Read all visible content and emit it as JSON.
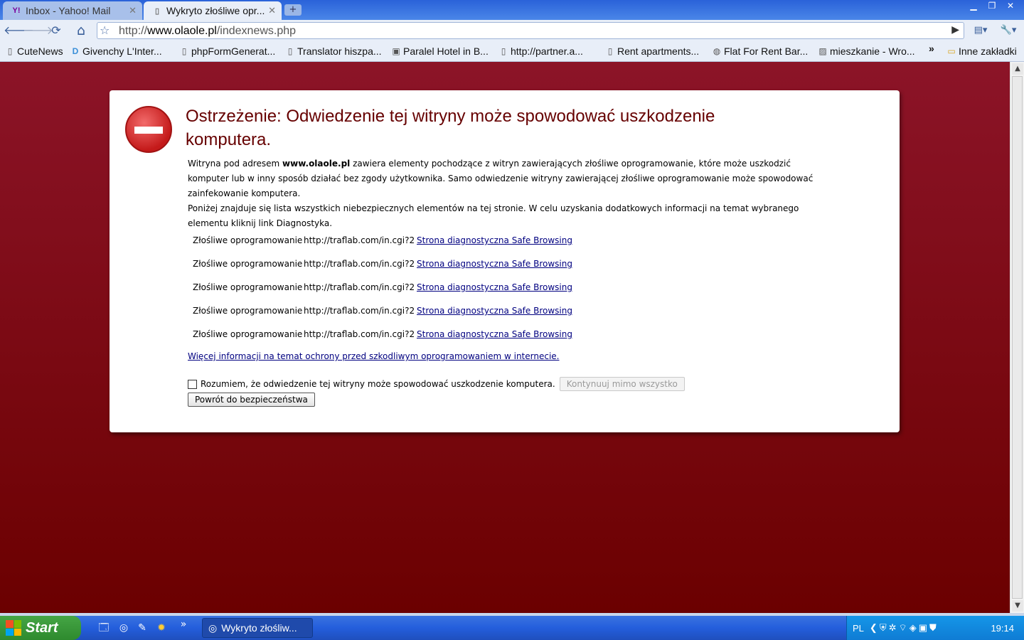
{
  "tabs": [
    {
      "title": "Inbox - Yahoo! Mail",
      "favicon": "Y!",
      "active": false
    },
    {
      "title": "Wykryto złośliwe opr...",
      "favicon": "▯",
      "active": true
    }
  ],
  "window_controls": {
    "minimize": "▁",
    "maximize": "❐",
    "close": "✕"
  },
  "toolbar": {
    "back_icon": "🡐",
    "forward_icon": "🡒",
    "reload_icon": "⟳",
    "home_icon": "⌂",
    "star_icon": "☆",
    "url_prefix": "http://",
    "url_host": "www.olaole.pl",
    "url_path": "/indexnews.php",
    "go_icon": "▶",
    "page_menu_icon": "▤▾",
    "wrench_icon": "🔧▾"
  },
  "bookmarks": [
    {
      "label": "CuteNews",
      "icon": "▯"
    },
    {
      "label": "Givenchy L'Inter...",
      "icon": "D"
    },
    {
      "label": "phpFormGenerat...",
      "icon": "▯"
    },
    {
      "label": "Translator hiszpa...",
      "icon": "▯"
    },
    {
      "label": "Paralel Hotel in B...",
      "icon": "▣"
    },
    {
      "label": "http://partner.a...",
      "icon": "▯"
    },
    {
      "label": "Rent apartments...",
      "icon": "▯"
    },
    {
      "label": "Flat For Rent Bar...",
      "icon": "◍"
    },
    {
      "label": "mieszkanie - Wro...",
      "icon": "▨"
    }
  ],
  "bookmarks_overflow": "»",
  "other_bookmarks": "Inne zakładki",
  "warning": {
    "headline": "Ostrzeżenie: Odwiedzenie tej witryny może spowodować uszkodzenie komputera.",
    "p1_before": "Witryna pod adresem ",
    "p1_site": "www.olaole.pl",
    "p1_after": " zawiera elementy pochodzące z witryn zawierających złośliwe oprogramowanie, które może uszkodzić komputer lub w inny sposób działać bez zgody użytkownika. Samo odwiedzenie witryny zawierającej złośliwe oprogramowanie może spowodować zainfekowanie komputera.",
    "p2": "Poniżej znajduje się lista wszystkich niebezpiecznych elementów na tej stronie. W celu uzyskania dodatkowych informacji na temat wybranego elementu kliknij link Diagnostyka.",
    "threats": [
      {
        "type": "Złośliwe oprogramowanie",
        "url": "http://traflab.com/in.cgi?2",
        "link": "Strona diagnostyczna Safe Browsing"
      },
      {
        "type": "Złośliwe oprogramowanie",
        "url": "http://traflab.com/in.cgi?2",
        "link": "Strona diagnostyczna Safe Browsing"
      },
      {
        "type": "Złośliwe oprogramowanie",
        "url": "http://traflab.com/in.cgi?2",
        "link": "Strona diagnostyczna Safe Browsing"
      },
      {
        "type": "Złośliwe oprogramowanie",
        "url": "http://traflab.com/in.cgi?2",
        "link": "Strona diagnostyczna Safe Browsing"
      },
      {
        "type": "Złośliwe oprogramowanie",
        "url": "http://traflab.com/in.cgi?2",
        "link": "Strona diagnostyczna Safe Browsing"
      }
    ],
    "more_info": "Więcej informacji na temat ochrony przed szkodliwym oprogramowaniem w internecie.",
    "acknowledge": "Rozumiem, że odwiedzenie tej witryny może spowodować uszkodzenie komputera.",
    "continue_button": "Kontynuuj mimo wszystko",
    "back_button": "Powrót do bezpieczeństwa"
  },
  "taskbar": {
    "start": "Start",
    "quicklaunch_overflow": "»",
    "task_title": "Wykryto złośliw...",
    "language": "PL",
    "clock": "19:14"
  },
  "colors": {
    "page_bg": "#8c1428",
    "headline": "#660000",
    "link": "#000080"
  }
}
